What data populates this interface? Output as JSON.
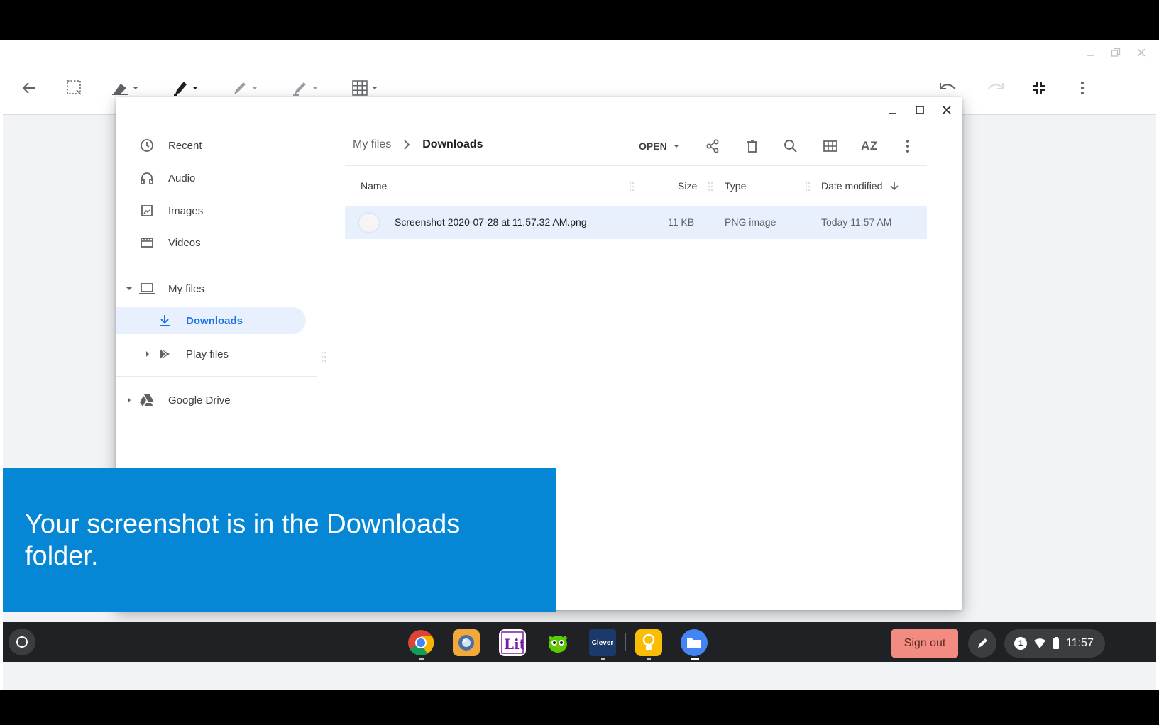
{
  "files_app": {
    "nav": {
      "recent": "Recent",
      "audio": "Audio",
      "images": "Images",
      "videos": "Videos",
      "my_files": "My files",
      "downloads": "Downloads",
      "play_files": "Play files",
      "google_drive": "Google Drive"
    },
    "breadcrumb": {
      "root": "My files",
      "current": "Downloads"
    },
    "toolbar": {
      "open": "OPEN",
      "sort_label": "AZ"
    },
    "columns": {
      "name": "Name",
      "size": "Size",
      "type": "Type",
      "date_modified": "Date modified"
    },
    "file": {
      "name": "Screenshot 2020-07-28 at 11.57.32 AM.png",
      "size": "11 KB",
      "type": "PNG image",
      "date": "Today 11:57 AM"
    }
  },
  "caption": "Your screenshot is in the Downloads folder.",
  "shelf": {
    "apps": [
      "chrome",
      "camera-app",
      "lit-app",
      "duolingo",
      "clever",
      "keep",
      "files"
    ],
    "clever_label": "Clever",
    "sign_out": "Sign out",
    "notification_count": "1",
    "time": "11:57"
  },
  "colors": {
    "accent": "#1a73e8",
    "selection": "#e8f0fe",
    "caption_bg": "#0587d6",
    "sign_out_bg": "#f28b82",
    "shelf_bg": "#202124"
  }
}
